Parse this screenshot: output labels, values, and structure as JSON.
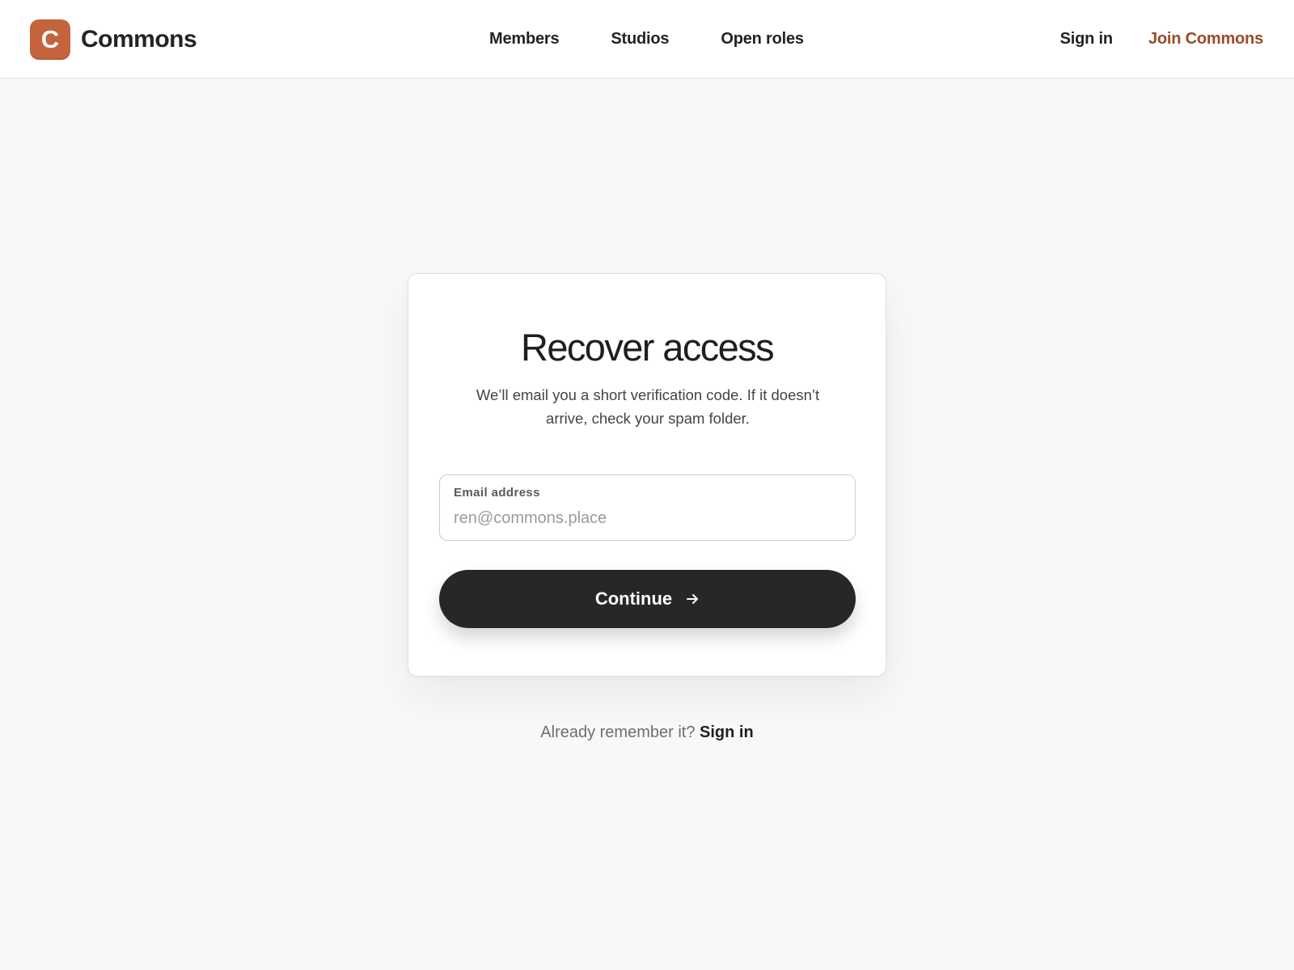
{
  "brand": {
    "logo_letter": "C",
    "name": "Commons",
    "accent": "#c4633c"
  },
  "nav": {
    "main": [
      {
        "label": "Members"
      },
      {
        "label": "Studios"
      },
      {
        "label": "Open roles"
      }
    ],
    "sign_in": "Sign in",
    "join": "Join Commons",
    "join_color": "#9b4a2a"
  },
  "card": {
    "title": "Recover access",
    "subtitle": "We’ll email you a short verification code. If it doesn’t arrive, check your spam folder.",
    "email": {
      "label": "Email address",
      "placeholder": "ren@commons.place",
      "value": ""
    },
    "continue_label": "Continue",
    "continue_icon": "arrow-right-icon"
  },
  "footer": {
    "prompt": "Already remember it?",
    "link": "Sign in"
  }
}
